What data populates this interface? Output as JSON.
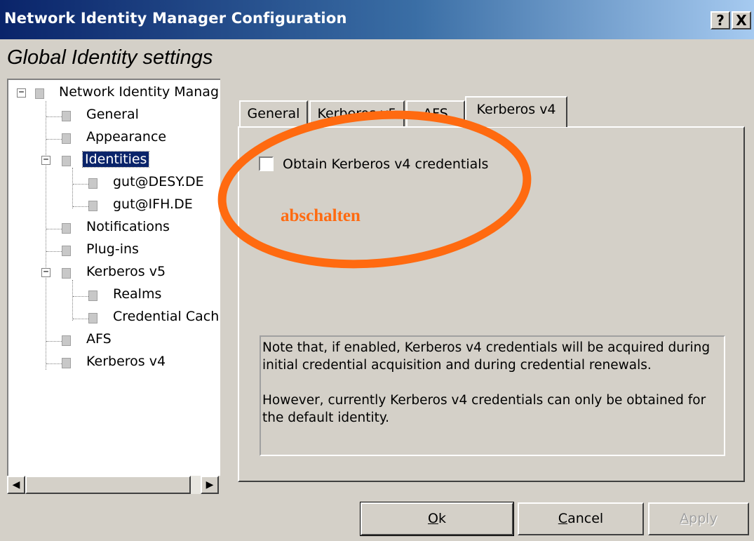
{
  "window": {
    "title": "Network Identity Manager Configuration",
    "help_glyph": "?",
    "close_glyph": "X"
  },
  "heading": "Global Identity settings",
  "tree": {
    "root": "Network Identity Manag",
    "general": "General",
    "appearance": "Appearance",
    "identities": "Identities",
    "identity_1": "gut@DESY.DE",
    "identity_2": "gut@IFH.DE",
    "notifications": "Notifications",
    "plugins": "Plug-ins",
    "kerberos_v5": "Kerberos v5",
    "realms": "Realms",
    "credential_cache": "Credential Cach",
    "afs": "AFS",
    "kerberos_v4": "Kerberos v4",
    "selected": "Identities"
  },
  "scrollbar": {
    "left_glyph": "◀",
    "right_glyph": "▶"
  },
  "tabs": {
    "general": "General",
    "kerberos_v5": "Kerberos v5",
    "afs": "AFS",
    "kerberos_v4": "Kerberos v4",
    "active": "Kerberos v4"
  },
  "kerberos_v4_tab": {
    "checkbox_label": "Obtain Kerberos v4 credentials",
    "checkbox_checked": false,
    "note_p1": "Note that, if enabled, Kerberos v4 credentials will be acquired during initial credential acquisition and during credential renewals.",
    "note_p2": "However, currently Kerberos v4 credentials can only be obtained for the default identity."
  },
  "annotation": {
    "text": "abschalten",
    "color": "#ff6a10"
  },
  "buttons": {
    "ok_mnemonic": "O",
    "ok_rest": "k",
    "cancel_mnemonic": "C",
    "cancel_rest": "ancel",
    "apply_mnemonic": "A",
    "apply_rest": "pply"
  },
  "colors": {
    "title_bar": "#0a246a",
    "dialog_face": "#d4d0c8",
    "selection": "#0a246a"
  }
}
